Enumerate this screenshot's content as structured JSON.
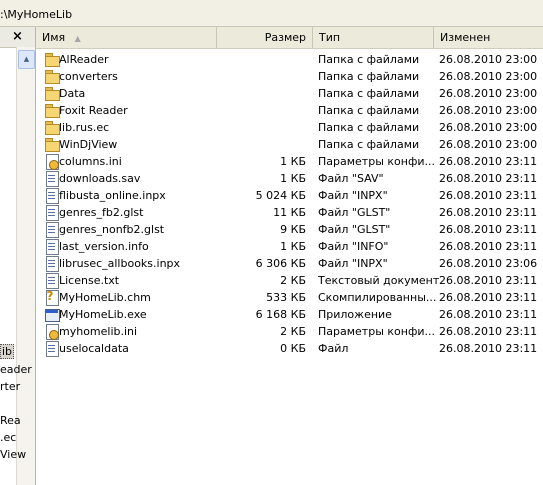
{
  "address": {
    "path": ":\\MyHomeLib"
  },
  "left_pane": {
    "close_glyph": "×",
    "scroll_up_glyph": "▲",
    "items": [
      "ib",
      "eader",
      "rter",
      "Rea",
      ".ec",
      "View"
    ]
  },
  "columns": {
    "name": "Имя",
    "size": "Размер",
    "type": "Тип",
    "modified": "Изменен",
    "sort_arrow": "▲"
  },
  "files": [
    {
      "icon": "folder-icon",
      "name": "AlReader",
      "size": "",
      "type": "Папка с файлами",
      "modified": "26.08.2010 23:00"
    },
    {
      "icon": "folder-icon",
      "name": "converters",
      "size": "",
      "type": "Папка с файлами",
      "modified": "26.08.2010 23:00"
    },
    {
      "icon": "folder-icon",
      "name": "Data",
      "size": "",
      "type": "Папка с файлами",
      "modified": "26.08.2010 23:00"
    },
    {
      "icon": "folder-icon",
      "name": "Foxit Reader",
      "size": "",
      "type": "Папка с файлами",
      "modified": "26.08.2010 23:00"
    },
    {
      "icon": "folder-icon",
      "name": "lib.rus.ec",
      "size": "",
      "type": "Папка с файлами",
      "modified": "26.08.2010 23:00"
    },
    {
      "icon": "folder-icon",
      "name": "WinDjView",
      "size": "",
      "type": "Папка с файлами",
      "modified": "26.08.2010 23:00"
    },
    {
      "icon": "settings-file-icon",
      "name": "columns.ini",
      "size": "1 КБ",
      "type": "Параметры конфи...",
      "modified": "26.08.2010 23:11"
    },
    {
      "icon": "document-file-icon",
      "name": "downloads.sav",
      "size": "1 КБ",
      "type": "Файл \"SAV\"",
      "modified": "26.08.2010 23:11"
    },
    {
      "icon": "document-file-icon",
      "name": "flibusta_online.inpx",
      "size": "5 024 КБ",
      "type": "Файл \"INPX\"",
      "modified": "26.08.2010 23:11"
    },
    {
      "icon": "document-file-icon",
      "name": "genres_fb2.glst",
      "size": "11 КБ",
      "type": "Файл \"GLST\"",
      "modified": "26.08.2010 23:11"
    },
    {
      "icon": "document-file-icon",
      "name": "genres_nonfb2.glst",
      "size": "9 КБ",
      "type": "Файл \"GLST\"",
      "modified": "26.08.2010 23:11"
    },
    {
      "icon": "document-file-icon",
      "name": "last_version.info",
      "size": "1 КБ",
      "type": "Файл \"INFO\"",
      "modified": "26.08.2010 23:11"
    },
    {
      "icon": "document-file-icon",
      "name": "librusec_allbooks.inpx",
      "size": "6 306 КБ",
      "type": "Файл \"INPX\"",
      "modified": "26.08.2010 23:06"
    },
    {
      "icon": "text-file-icon",
      "name": "License.txt",
      "size": "2 КБ",
      "type": "Текстовый документ",
      "modified": "26.08.2010 23:11"
    },
    {
      "icon": "help-file-icon",
      "name": "MyHomeLib.chm",
      "size": "533 КБ",
      "type": "Скомпилированны...",
      "modified": "26.08.2010 23:11"
    },
    {
      "icon": "application-icon",
      "name": "MyHomeLib.exe",
      "size": "6 168 КБ",
      "type": "Приложение",
      "modified": "26.08.2010 23:11"
    },
    {
      "icon": "settings-file-icon",
      "name": "myhomelib.ini",
      "size": "2 КБ",
      "type": "Параметры конфи...",
      "modified": "26.08.2010 23:11"
    },
    {
      "icon": "document-file-icon",
      "name": "uselocaldata",
      "size": "0 КБ",
      "type": "Файл",
      "modified": "26.08.2010 23:11"
    }
  ]
}
